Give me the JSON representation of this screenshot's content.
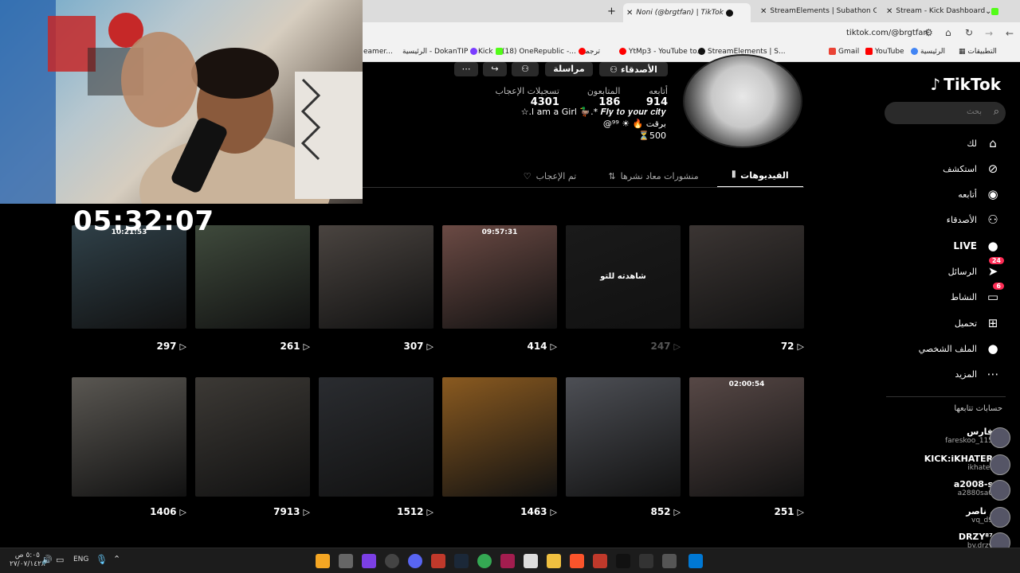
{
  "browser": {
    "tabs": [
      {
        "label": "Stream - Kick Dashboard",
        "color": "#53fc18"
      },
      {
        "label": "StreamElements | Subathon Co",
        "color": "#111111"
      },
      {
        "label": "Noni (@brgtfan) | TikTok",
        "color": "#111111"
      }
    ],
    "address": "tiktok.com/@brgtfan",
    "bookmarks": [
      "التطبيقات",
      "الرئيسية",
      "YouTube",
      "Gmail",
      "StreamElements | S...",
      "YtMp3 - YouTube to...",
      "ترجمة",
      "(18) OneRepublic -...",
      "Kick",
      "الرئيسية - DokanTIP",
      "eamer..."
    ]
  },
  "stream": {
    "timer": "05:32:07"
  },
  "sidebar": {
    "logo": "TikTok",
    "search_placeholder": "بحث",
    "nav": [
      {
        "label": "لك",
        "icon": "home-icon",
        "glyph": "⌂"
      },
      {
        "label": "استكشف",
        "icon": "compass-icon",
        "glyph": "⊘"
      },
      {
        "label": "أتابعه",
        "icon": "following-icon",
        "glyph": "◉"
      },
      {
        "label": "الأصدقاء",
        "icon": "friends-icon",
        "glyph": "⚇"
      },
      {
        "label": "LIVE",
        "icon": "live-icon",
        "glyph": "●"
      },
      {
        "label": "الرسائل",
        "icon": "messages-icon",
        "glyph": "➤",
        "badge": "24"
      },
      {
        "label": "النشاط",
        "icon": "activity-icon",
        "glyph": "▭",
        "badge": "6"
      },
      {
        "label": "تحميل",
        "icon": "upload-icon",
        "glyph": "⊞"
      },
      {
        "label": "الملف الشخصي",
        "icon": "profile-icon",
        "glyph": "●"
      },
      {
        "label": "المزيد",
        "icon": "more-icon",
        "glyph": "⋯"
      }
    ],
    "following_title": "حسابات تتابعها",
    "accounts": [
      {
        "name": "فارس",
        "handle": "fareskoo_115"
      },
      {
        "name": "KICK:iKHATER",
        "handle": "ikhater"
      },
      {
        "name": "a2008-s",
        "handle": "a2880sa0"
      },
      {
        "name": "ناصر .",
        "handle": "vq_d9"
      },
      {
        "name": "DRZY⁸⁷",
        "handle": "by.drzy"
      }
    ]
  },
  "profile": {
    "buttons": {
      "friends": "الأصدقاء",
      "message": "مراسلة"
    },
    "stats": {
      "following_label": "أتابعه",
      "following": "914",
      "followers_label": "المتابعون",
      "followers": "186",
      "likes_label": "تسجيلات الإعجاب",
      "likes": "4301"
    },
    "bio_lines": [
      "☆.l am a Girl 🦆.* 𝑭𝒍𝒚 𝒕𝒐 𝒚𝒐𝒖𝒓 𝒄𝒊𝒕𝒚",
      "@برقت 🔥 ☀ ⁹⁹",
      "⏳500"
    ],
    "tabs": [
      {
        "label": "الفيديوهات",
        "icon": "grid-icon",
        "active": true
      },
      {
        "label": "منشورات معاد نشرها",
        "icon": "repost-icon",
        "active": false
      },
      {
        "label": "تم الإعجاب",
        "icon": "like-icon",
        "active": false
      }
    ]
  },
  "videos": [
    {
      "count": "72",
      "overlay": ""
    },
    {
      "count": "247",
      "overlay": "شاهدته للتو"
    },
    {
      "count": "414",
      "overlay": "09:57:31"
    },
    {
      "count": "307",
      "overlay": ""
    },
    {
      "count": "261",
      "overlay": ""
    },
    {
      "count": "297",
      "overlay": "10:21:53"
    },
    {
      "count": "251",
      "overlay": "02:00:54"
    },
    {
      "count": "852",
      "overlay": ""
    },
    {
      "count": "1463",
      "overlay": ""
    },
    {
      "count": "1512",
      "overlay": ""
    },
    {
      "count": "7913",
      "overlay": ""
    },
    {
      "count": "1406",
      "overlay": ""
    }
  ],
  "taskbar": {
    "clock_time": "٥:٠٥ ص",
    "clock_date": "٢٧/٠٧/١٤٢٨",
    "lang": "ENG"
  },
  "colors": {
    "accent": "#fe2c55",
    "bg": "#000000"
  }
}
